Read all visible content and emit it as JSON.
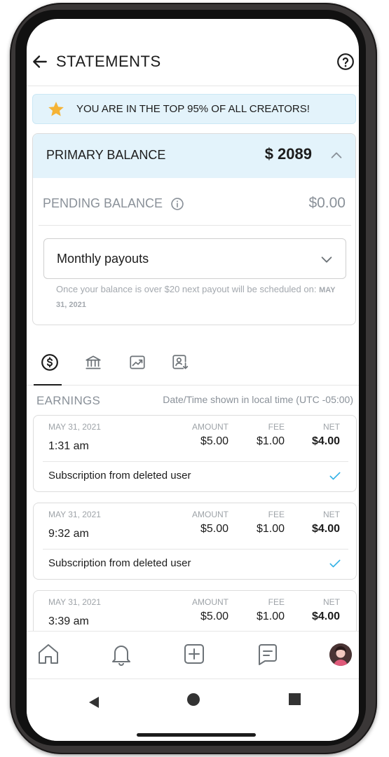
{
  "header": {
    "title": "STATEMENTS",
    "back_icon": "arrow-left-icon",
    "help_icon": "question-circle-icon"
  },
  "banner": {
    "icon": "star-icon",
    "icon_color": "#f5b335",
    "text": "YOU ARE IN THE TOP 95% OF ALL CREATORS!"
  },
  "balance": {
    "primary_label": "PRIMARY BALANCE",
    "primary_amount": "$ 2089",
    "pending_label": "PENDING BALANCE",
    "pending_amount": "$0.00",
    "payout_option": "Monthly payouts",
    "payout_note": "Once your balance is over $20 next payout will be scheduled on:",
    "payout_date": "MAY 31, 2021"
  },
  "tabs": [
    {
      "icon": "dollar-circle-icon",
      "active": true
    },
    {
      "icon": "bank-icon",
      "active": false
    },
    {
      "icon": "chart-trend-icon",
      "active": false
    },
    {
      "icon": "user-download-icon",
      "active": false
    }
  ],
  "earnings": {
    "title": "EARNINGS",
    "timezone_note": "Date/Time shown in local time (UTC -05:00)",
    "columns": {
      "amount": "AMOUNT",
      "fee": "FEE",
      "net": "NET"
    },
    "transactions": [
      {
        "date": "MAY 31, 2021",
        "time": "1:31 am",
        "amount": "$5.00",
        "fee": "$1.00",
        "net": "$4.00",
        "description": "Subscription from deleted user"
      },
      {
        "date": "MAY 31, 2021",
        "time": "9:32 am",
        "amount": "$5.00",
        "fee": "$1.00",
        "net": "$4.00",
        "description": "Subscription from deleted user"
      },
      {
        "date": "MAY 31, 2021",
        "time": "3:39 am",
        "amount": "$5.00",
        "fee": "$1.00",
        "net": "$4.00",
        "description": ""
      }
    ]
  },
  "bottom_nav": [
    "home-icon",
    "bell-icon",
    "plus-square-icon",
    "message-icon",
    "avatar"
  ],
  "system_nav": [
    "back-triangle-icon",
    "home-circle-icon",
    "recents-square-icon"
  ],
  "colors": {
    "accent_light": "#e3f3fb",
    "check": "#31b1e6",
    "muted": "#8a9199"
  }
}
